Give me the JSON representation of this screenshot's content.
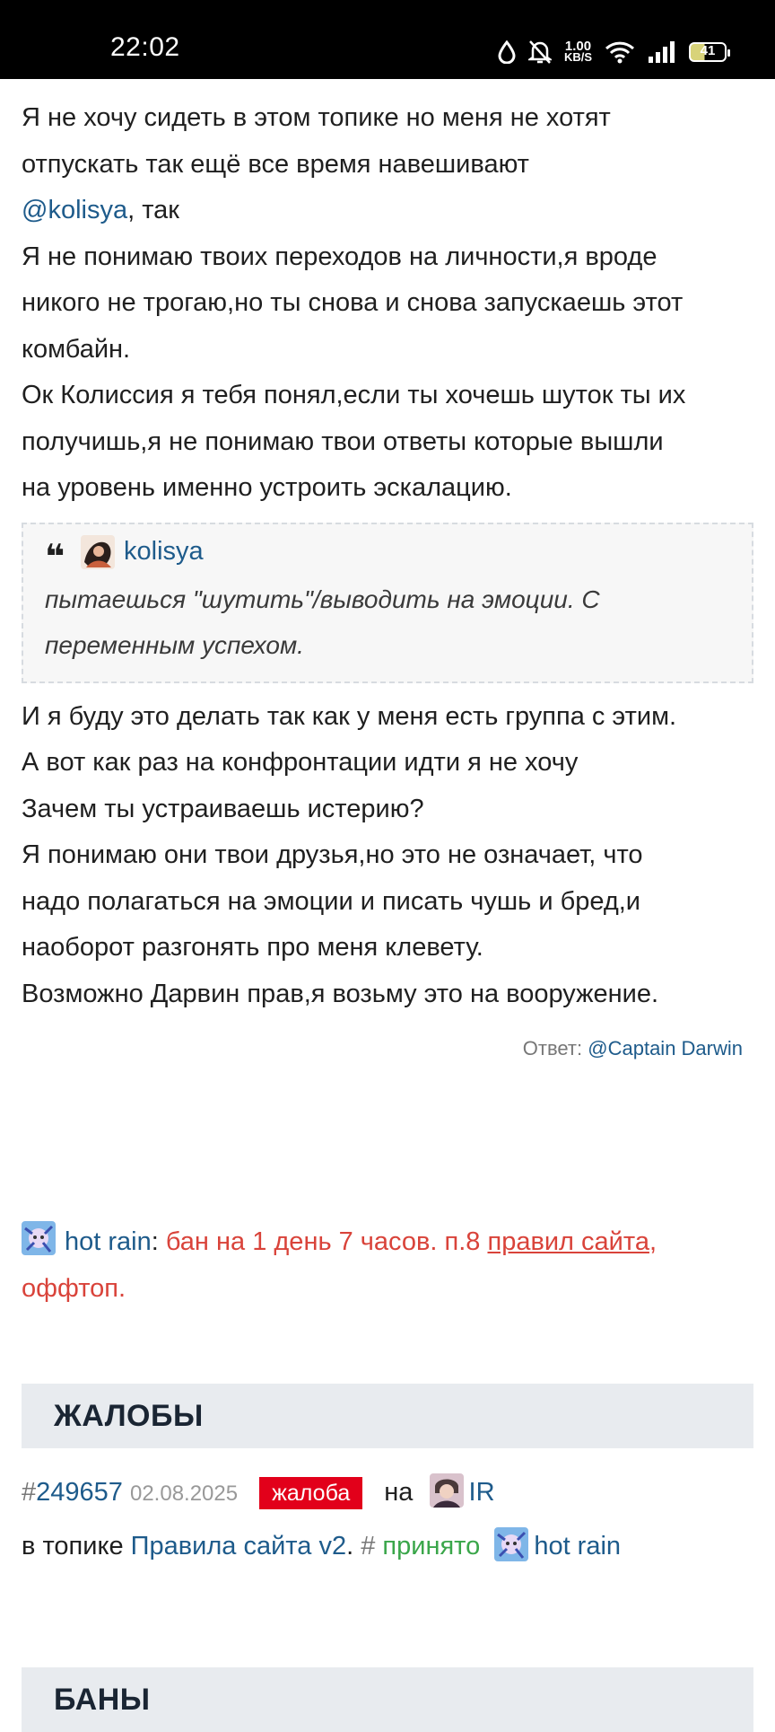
{
  "status_bar": {
    "time": "22:02",
    "net_speed_value": "1.00",
    "net_speed_unit": "KB/S",
    "battery": "41"
  },
  "post": {
    "lines": [
      "Я не хочу сидеть в этом топике но меня не хотят",
      "отпускать так ещё все время навешивают"
    ],
    "mention_line": {
      "mention": "@kolisya",
      "suffix": ", так"
    },
    "lines2": [
      "Я не понимаю твоих переходов на личности,я вроде",
      "никого не трогаю,но ты снова и снова запускаешь этот",
      "комбайн.",
      "Ок Колиссия я тебя понял,если ты хочешь шуток ты их",
      "получишь,я не понимаю твои ответы которые вышли",
      "на уровень именно устроить эскалацию."
    ],
    "quote": {
      "author": "kolisya",
      "lines": [
        "пытаешься \"шутить\"/выводить на эмоции. С",
        "переменным успехом."
      ]
    },
    "lines3": [
      "И я буду это делать так как у меня есть группа с этим.",
      "А вот как раз на конфронтации идти я не хочу",
      "Зачем ты устраиваешь истерию?",
      "Я понимаю они твои друзья,но это не означает, что",
      "надо полагаться на эмоции и писать чушь и бред,и",
      "наоборот разгонять про меня клевету.",
      "Возможно Дарвин прав,я возьму это на вооружение."
    ],
    "reply_to": {
      "prefix": "Ответ:",
      "at": "@",
      "user": "Captain Darwin"
    }
  },
  "ban_note": {
    "user": "hot rain",
    "colon": ":",
    "text": "бан на 1 день 7 часов. п.8",
    "link": "правил сайта",
    "comma": ",",
    "line2": "оффтоп."
  },
  "complaints": {
    "title": "ЖАЛОБЫ",
    "report": {
      "hash": "#",
      "id": "249657",
      "date": "02.08.2025",
      "badge": "жалоба",
      "on": "на",
      "target": "IR",
      "in_topic": "в топике",
      "topic": "Правила сайта v2",
      "dot": ".",
      "hash2": "#",
      "status": "принято",
      "moderator": "hot rain"
    }
  },
  "bans": {
    "title": "БАНЫ"
  },
  "colors": {
    "link": "#1e5b8b",
    "ban_red": "#d9433a",
    "badge_red": "#e2001a",
    "accepted_green": "#3aa64a",
    "section_bg": "#e8ebef"
  }
}
